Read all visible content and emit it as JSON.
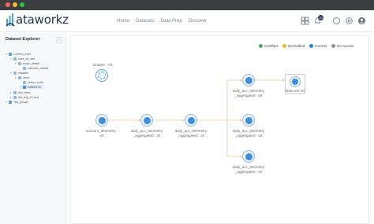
{
  "window": {
    "dots": [
      "#fe5f57",
      "#febc2e",
      "#28c840"
    ]
  },
  "header": {
    "logo_text": "ataworkz",
    "nav": [
      "Home",
      "Datasets",
      "Data Prep",
      "Discover"
    ],
    "notification_count": "10",
    "icons": [
      "grid-icon",
      "bell-icon",
      "chat-icon",
      "gear-icon",
      "user-icon"
    ]
  },
  "sidebar": {
    "title": "Dataset Explorer",
    "collapse_label": "«",
    "tree": [
      {
        "label": "Connect_Dev1",
        "level": 0
      },
      {
        "label": "store_dw_test",
        "level": 1
      },
      {
        "label": "scope_default",
        "level": 2
      },
      {
        "label": "collection_default",
        "level": 3
      },
      {
        "label": "datasets",
        "level": 1
      },
      {
        "label": "demo",
        "level": 2
      },
      {
        "label": "airline_routes",
        "level": 3
      },
      {
        "label": "Dataset V0",
        "level": 3,
        "selected": true
      },
      {
        "label": "dev_views",
        "level": 1
      },
      {
        "label": "dev_avg_10_test",
        "level": 1
      },
      {
        "label": "Test_groupe",
        "level": 0
      }
    ]
  },
  "legend": [
    {
      "label": "Certified",
      "color": "#4caf50"
    },
    {
      "label": "Uncertified",
      "color": "#f5b932"
    },
    {
      "label": "Current",
      "color": "#2f7fd8"
    },
    {
      "label": "No access",
      "color": "#8a8f98"
    }
  ],
  "lineage": {
    "grades": {
      "label": "Grades : V0"
    },
    "account": {
      "label1": "account_telemetry :",
      "label2": "v0"
    },
    "agg1": {
      "label1": "daily_acc_telemetry",
      "label2": "_aggregated : v0"
    },
    "agg2": {
      "label1": "daily_acc_telemetry",
      "label2": "_aggregated : v0"
    },
    "top": {
      "label1": "daily_acc_telemetry",
      "label2": "_aggregated : v0"
    },
    "mid": {
      "label1": "daily_acc_telemetry",
      "label2": "_aggregated : v0"
    },
    "bot": {
      "label1": "daily_acc_telemetry",
      "label2": "_aggregated : v0"
    },
    "dataset": {
      "label": "Data set V0"
    }
  }
}
